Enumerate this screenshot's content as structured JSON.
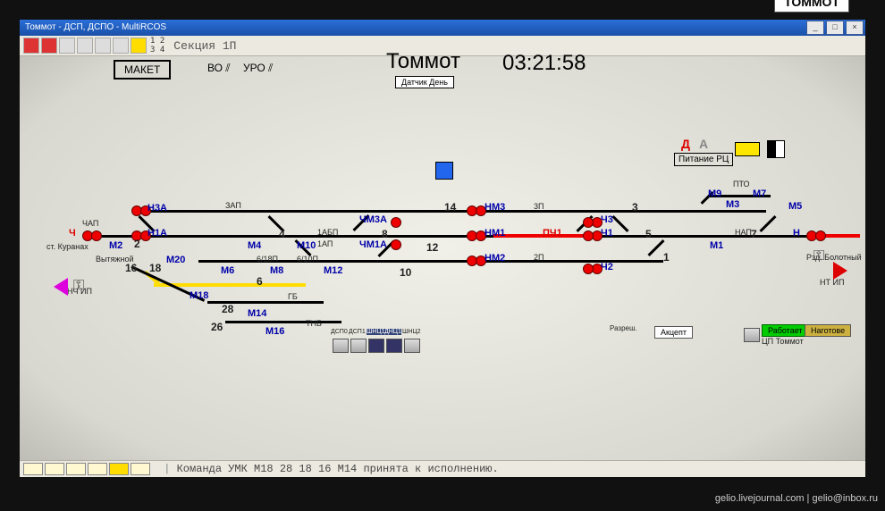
{
  "window": {
    "title": "Томмот - ДСП, ДСПО - MultiRCOS",
    "section": "Секция 1П"
  },
  "station_tag": "ТОММОТ",
  "header": {
    "maket": "МАКЕТ",
    "bo": "ВО ⫽",
    "uro": "УРО ⫽",
    "station": "Томмот",
    "daynight": "Датчик День",
    "clock": "03:21:58",
    "d": "Д",
    "a": "А",
    "pit": "Питание РЦ"
  },
  "signals": {
    "n3a": "Н3А",
    "n1a": "Н1А",
    "nm3": "НМ3",
    "nm1": "НМ1",
    "nm2": "НМ2",
    "chm3a": "ЧМ3А",
    "chm1a": "ЧМ1А",
    "ch3": "Ч3",
    "ch1": "Ч1",
    "ch2": "Ч2",
    "pch1": "ПЧ1",
    "n": "Н",
    "ch": "Ч",
    "m2": "М2",
    "m4": "М4",
    "m6": "М6",
    "m8": "М8",
    "m10": "М10",
    "m12": "М12",
    "m14": "М14",
    "m16": "М16",
    "m18": "М18",
    "m20": "М20",
    "m1": "М1",
    "m3": "М3",
    "m5": "М5",
    "m7": "М7",
    "m9": "М9"
  },
  "tracks": {
    "t2": "2",
    "t4": "4",
    "t6": "6",
    "t8": "8",
    "t10": "10",
    "t12": "12",
    "t14": "14",
    "t16": "16",
    "t18": "18",
    "t1": "1",
    "t3": "3",
    "t5": "5",
    "t7": "7",
    "t26": "26",
    "t28": "28",
    "zap": "ЗАП",
    "nap": "НАП",
    "chap": "ЧАП",
    "ap1": "1АП",
    "bp1a": "1АБП",
    "p3": "3П",
    "p2": "2П",
    "p6_18": "6/18П",
    "p6_10": "6/10П",
    "gb": "ГБ",
    "tnb": "ТНБ",
    "pto": "ПТО",
    "nchip": "НЧ ИП",
    "nt_ip": "НТ ИП",
    "vyt": "Вытяжной",
    "kur": "ст. Куранах",
    "bol": "Рзд. Болотный"
  },
  "controls": {
    "razresh": "Разреш.",
    "absent": "Акцепт",
    "rabotaet": "Работает",
    "nagotove": "Наготове",
    "cp": "ЦП Томмот",
    "dsp0": "ДСП0",
    "dsp1": "ДСП1",
    "shn": "ШНЦ1",
    "dnc": "ДНЦ1",
    "shnc2": "ШНЦ2"
  },
  "footer": {
    "cmd": "Команда УМК M18 28 18 16 M14 принята к исполнению."
  },
  "watermark": "gelio.livejournal.com | gelio@inbox.ru"
}
